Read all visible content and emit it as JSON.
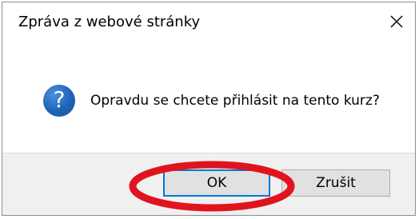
{
  "dialog": {
    "title": "Zpráva z webové stránky",
    "message": "Opravdu se chcete přihlásit na tento kurz?",
    "icon": "question-icon",
    "icon_glyph": "?",
    "buttons": {
      "ok_label": "OK",
      "cancel_label": "Zrušit"
    }
  },
  "colors": {
    "accent": "#0078d7",
    "icon_blue": "#1f63b8",
    "highlight_red": "#e0141e",
    "footer_bg": "#f0f0f0",
    "button_bg": "#e1e1e1"
  }
}
